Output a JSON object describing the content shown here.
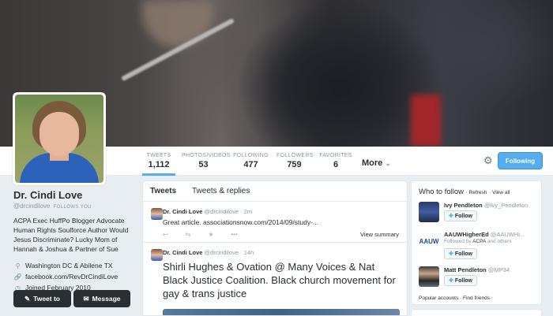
{
  "nav": {
    "items": [
      {
        "label": "TWEETS",
        "value": "1,112"
      },
      {
        "label": "PHOTOS/VIDEOS",
        "value": "53"
      },
      {
        "label": "FOLLOWING",
        "value": "477"
      },
      {
        "label": "FOLLOWERS",
        "value": "759"
      },
      {
        "label": "FAVORITES",
        "value": "6"
      }
    ],
    "more_label": "More",
    "follow_button": "Following"
  },
  "profile": {
    "name": "Dr. Cindi Love",
    "handle": "@drcindilove",
    "follows_you": "FOLLOWS YOU",
    "bio": "ACPA Exec HuffPo Blogger Advocate Human Rights Soulforce Author Would Jesus Discriminate? Lucky Mom of Hannah & Joshua & Partner of Sue",
    "location": "Washington DC & Abilene TX",
    "website": "facebook.com/RevDrCindiLove",
    "joined": "Joined February 2010",
    "tweet_to_button": "Tweet to",
    "message_button": "Message"
  },
  "timeline": {
    "tabs": [
      "Tweets",
      "Tweets & replies"
    ],
    "tweets": [
      {
        "name": "Dr. Cindi Love",
        "handle": "@drcindilove",
        "time": "2m",
        "text": "Great article.  associationsnow.com/2014/09/study-...",
        "view_summary": "View summary"
      },
      {
        "name": "Dr. Cindi Love",
        "handle": "@drcindilove",
        "time": "14h",
        "text": "Shirli Hughes & Ovation @ Many Voices & Nat Black Justice Coalition. Black  church movement for gay & trans justice"
      }
    ]
  },
  "who_to_follow": {
    "title": "Who to follow",
    "refresh": "Refresh",
    "view_all": "View all",
    "suggestions": [
      {
        "name": "Ivy Pendleton",
        "handle": "@Ivy_Pendleton",
        "sub": "",
        "follow": "Follow"
      },
      {
        "name": "AAUWHigherEd",
        "handle": "@AAUWHi...",
        "sub_prefix": "Followed by",
        "sub_bold": "ACPA",
        "sub_suffix": "and others",
        "follow": "Follow"
      },
      {
        "name": "Matt Pendleton",
        "handle": "@MP34",
        "sub": "",
        "follow": "Follow"
      }
    ],
    "footer": "Popular accounts · Find friends"
  }
}
